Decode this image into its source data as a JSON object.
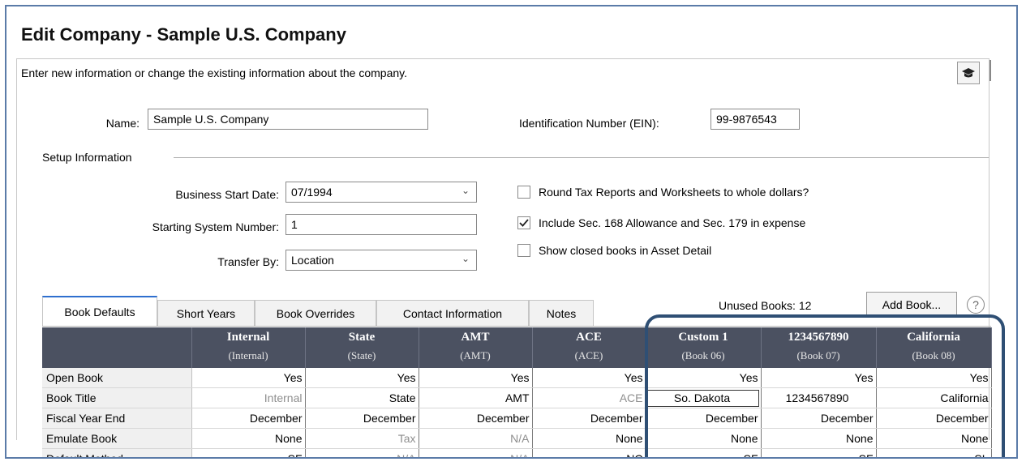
{
  "title": "Edit Company - Sample U.S. Company",
  "description": "Enter new information or change the existing information about the company.",
  "name": {
    "label": "Name:",
    "value": "Sample U.S. Company"
  },
  "ein": {
    "label": "Identification Number (EIN):",
    "value": "99-9876543"
  },
  "setup": {
    "section_label": "Setup Information",
    "business_start_date": {
      "label": "Business Start Date:",
      "value": "07/1994"
    },
    "starting_system_number": {
      "label": "Starting System Number:",
      "value": "1"
    },
    "transfer_by": {
      "label": "Transfer By:",
      "value": "Location"
    },
    "options": [
      {
        "label": "Round Tax Reports and Worksheets to whole dollars?",
        "checked": false
      },
      {
        "label": "Include Sec. 168 Allowance and Sec. 179 in expense",
        "checked": true
      },
      {
        "label": "Show closed books in Asset Detail",
        "checked": false
      }
    ]
  },
  "tabs": [
    {
      "label": "Book Defaults",
      "active": true
    },
    {
      "label": "Short Years",
      "active": false
    },
    {
      "label": "Book Overrides",
      "active": false
    },
    {
      "label": "Contact Information",
      "active": false
    },
    {
      "label": "Notes",
      "active": false
    }
  ],
  "unused_books": "Unused Books: 12",
  "add_book_label": "Add Book...",
  "help_symbol": "?",
  "grid": {
    "columns": [
      {
        "name": "Internal",
        "sub": "(Internal)"
      },
      {
        "name": "State",
        "sub": "(State)"
      },
      {
        "name": "AMT",
        "sub": "(AMT)"
      },
      {
        "name": "ACE",
        "sub": "(ACE)"
      },
      {
        "name": "Custom 1",
        "sub": "(Book 06)"
      },
      {
        "name": "1234567890",
        "sub": "(Book 07)"
      },
      {
        "name": "California",
        "sub": "(Book 08)"
      }
    ],
    "rows": [
      {
        "label": "Open Book",
        "cells": [
          "Yes",
          "Yes",
          "Yes",
          "Yes",
          "Yes",
          "Yes",
          "Yes"
        ]
      },
      {
        "label": "Book Title",
        "cells": [
          "Internal",
          "State",
          "AMT",
          "ACE",
          "So. Dakota",
          "1234567890",
          "California"
        ]
      },
      {
        "label": "Fiscal Year End",
        "cells": [
          "December",
          "December",
          "December",
          "December",
          "December",
          "December",
          "December"
        ]
      },
      {
        "label": "Emulate Book",
        "cells": [
          "None",
          "Tax",
          "N/A",
          "None",
          "None",
          "None",
          "None"
        ]
      },
      {
        "label": "Default Method",
        "cells": [
          "SF",
          "N/A",
          "N/A",
          "NC",
          "SF",
          "SF",
          "SL"
        ]
      }
    ]
  },
  "colors": {
    "header_bg": "#4b5161",
    "highlight_border": "#2f4f74",
    "active_tab": "#2f6fcf"
  },
  "icons": {
    "help_button": "graduation-cap-icon",
    "dropdown": "chevron-down-icon",
    "checkmark": "checkmark-icon"
  }
}
